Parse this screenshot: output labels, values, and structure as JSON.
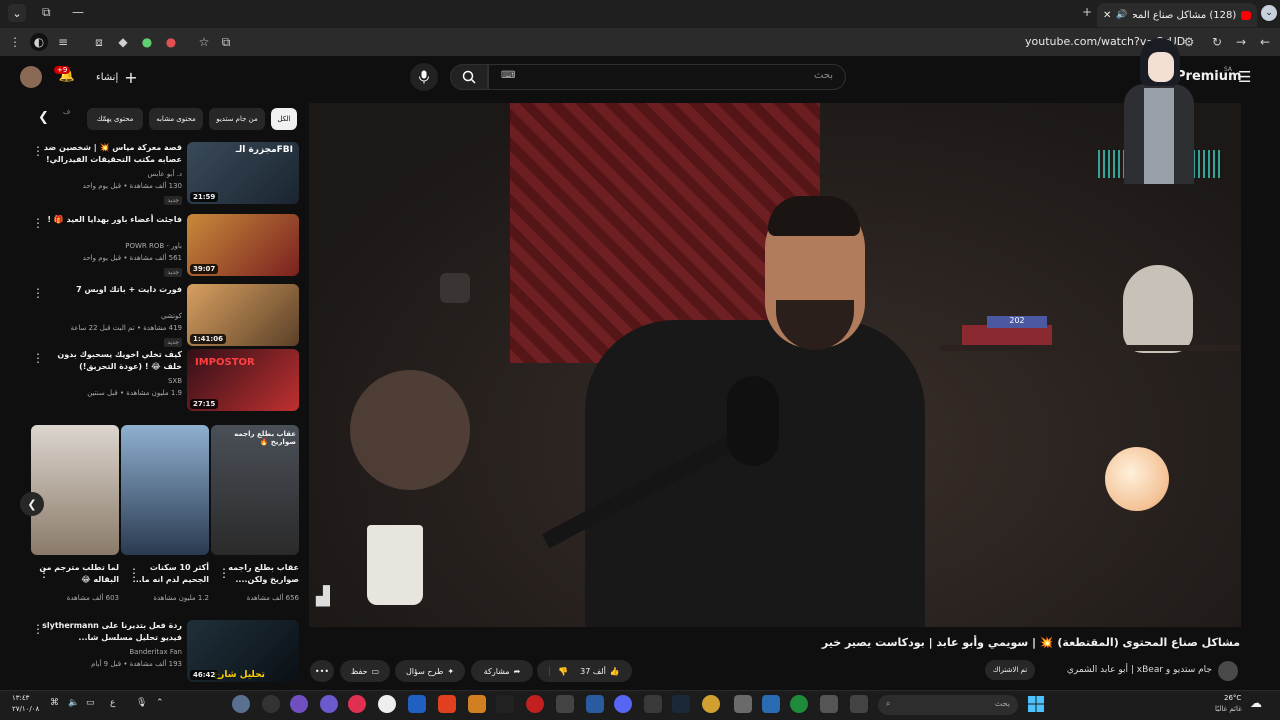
{
  "browser": {
    "tab_title": "(128) مشاكل صناع المحتوى (",
    "url": "youtube.com/watch?v=OrUD",
    "window_controls": [
      "—",
      "⧉",
      "✕"
    ]
  },
  "header": {
    "logo_text": "Premium",
    "region": "SA",
    "search_placeholder": "بحث",
    "create_label": "إنشاء",
    "notification_count": "+9"
  },
  "chips": [
    "الكل",
    "من جام ستديو",
    "محتوى مشابه",
    "محتوى يهمّك",
    "ف"
  ],
  "player": {
    "book_label": "202"
  },
  "video": {
    "title": "مشاكل صناع المحتوى (المقتطعة) 💥 | سويمي وأبو عابد | بودكاست يصير خير",
    "channel_line": "جام ستديو و xBear | أبو عابد الشمري",
    "subscribe_label": "تم الاشتراك",
    "like_count": "37 ألف",
    "share_label": "مشاركة",
    "ask_label": "طرح سؤال",
    "save_label": "حفظ"
  },
  "sidebar_videos": [
    {
      "title": "قصة معركة مياس 💥 | شخصين ضد عصابه مكتب التحقيقات الفيدرالي!",
      "channel": "د. أبو عابس",
      "meta": "130 ألف مشاهدة • قبل يوم واحد",
      "new": "جديد",
      "duration": "21:59",
      "thumb_text": "مجزرة الـFBI"
    },
    {
      "title": "فاجئت أعضاء باور بهدايا العيد 🎁 !",
      "channel": "باور - POWR ROB",
      "meta": "561 ألف مشاهدة • قبل يوم واحد",
      "new": "جديد",
      "duration": "39:07",
      "thumb_text": ""
    },
    {
      "title": "فورت دايت + باتك اوبس 7",
      "channel": "كوتشي",
      "meta": "419 مشاهدة • تم البث قبل 22 ساعة",
      "new": "جديد",
      "duration": "1:41:06",
      "thumb_text": ""
    },
    {
      "title": "كيف تخلي اخويك يسحبوك بدون خلف 😂 ! (عودة التحريق!)",
      "channel": "SXB",
      "meta": "1.9 مليون مشاهدة • قبل سنتين",
      "new": "",
      "duration": "27:15",
      "thumb_text": "IMPOSTOR"
    },
    {
      "title": "ردة فعل بتديرنا على slythermann فيديو تحليل مسلسل شا...",
      "channel": "Banderitax Fan",
      "meta": "193 ألف مشاهدة • قبل 9 أيام",
      "new": "",
      "duration": "46:42",
      "thumb_text": "تحليل شارع"
    }
  ],
  "shorts": [
    {
      "title": "عقاب بطلع راجمه صواريخ ولكن....",
      "views": "656 ألف مشاهدة",
      "thumb_text": "عقاب بطلع راجمه صواريخ 🔥"
    },
    {
      "title": "أكثر 10 سكنات الجحيم لدم انه ما...",
      "views": "1.2 مليون مشاهدة",
      "thumb_text": ""
    },
    {
      "title": "لما تطلب مترجم من البقاله 😂",
      "views": "603 ألف مشاهدة",
      "thumb_text": ""
    }
  ],
  "taskbar": {
    "search_placeholder": "بحث",
    "weather_temp": "26°C",
    "weather_desc": "غائم غالبًا",
    "time": "١٣:٤٣",
    "date": "٢٧/١٠/٠٨",
    "lang": "ع"
  },
  "colors": {
    "accent": "#ff0000",
    "background": "#0f0f0f",
    "chip_bg": "#272727"
  }
}
